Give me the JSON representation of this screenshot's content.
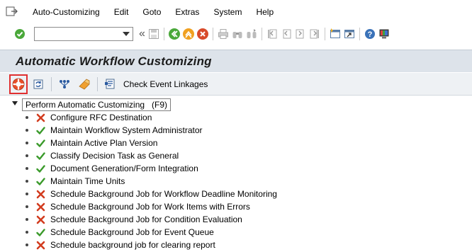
{
  "menubar": {
    "items": [
      "Auto-Customizing",
      "Edit",
      "Goto",
      "Extras",
      "System",
      "Help"
    ]
  },
  "toolbar": {
    "command_value": "",
    "command_placeholder": ""
  },
  "title": "Automatic Workflow Customizing",
  "app_toolbar": {
    "check_event_linkages_label": "Check Event Linkages"
  },
  "tooltip": "Perform Automatic Customizing   (F9)",
  "tree": {
    "items": [
      {
        "label": "Configure RFC Destination",
        "status": "error"
      },
      {
        "label": "Maintain Workflow System Administrator",
        "status": "ok"
      },
      {
        "label": "Maintain Active Plan Version",
        "status": "ok"
      },
      {
        "label": "Classify Decision Task as General",
        "status": "ok"
      },
      {
        "label": "Document Generation/Form Integration",
        "status": "ok"
      },
      {
        "label": "Maintain Time Units",
        "status": "ok"
      },
      {
        "label": "Schedule Background Job for Workflow Deadline Monitoring",
        "status": "error"
      },
      {
        "label": "Schedule Background Job for Work Items with Errors",
        "status": "error"
      },
      {
        "label": "Schedule Background Job for Condition Evaluation",
        "status": "error"
      },
      {
        "label": "Schedule Background Job for Event Queue",
        "status": "ok"
      },
      {
        "label": "Schedule background job for clearing report",
        "status": "error"
      }
    ]
  },
  "colors": {
    "ok": "#3a9a2a",
    "error": "#d23b1e",
    "title_bg": "#dde3ea",
    "highlight": "#e03030"
  },
  "icons": {
    "ok": "check-icon",
    "error": "cross-icon"
  }
}
